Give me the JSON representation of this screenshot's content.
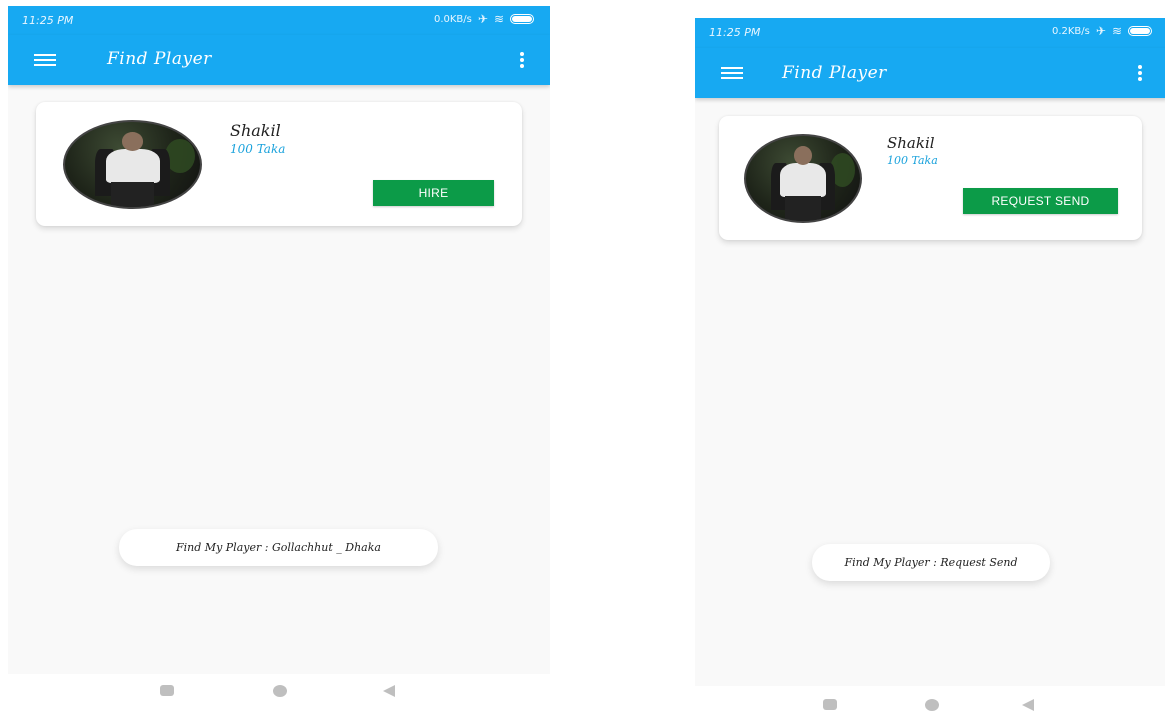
{
  "screens": [
    {
      "status_bar": {
        "time": "11:25 PM",
        "net_speed": "0.0KB/s"
      },
      "app_bar": {
        "title": "Find Player"
      },
      "player": {
        "name": "Shakil",
        "price": "100 Taka",
        "button_label": "HIRE"
      },
      "toast": {
        "text": "Find My Player : Gollachhut _ Dhaka"
      }
    },
    {
      "status_bar": {
        "time": "11:25 PM",
        "net_speed": "0.2KB/s"
      },
      "app_bar": {
        "title": "Find Player"
      },
      "player": {
        "name": "Shakil",
        "price": "100 Taka",
        "button_label": "REQUEST SEND"
      },
      "toast": {
        "text": "Find My Player : Request Send"
      }
    }
  ],
  "icons": {
    "menu": "hamburger-menu-icon",
    "overflow": "three-dot-overflow-icon",
    "airplane": "airplane-mode-icon",
    "wifi": "wifi-icon",
    "battery": "battery-icon",
    "nav_recent": "square-recents-icon",
    "nav_home": "circle-home-icon",
    "nav_back": "triangle-back-icon"
  },
  "colors": {
    "app_bar": "#17a9f2",
    "button": "#0c9b48",
    "price_text": "#1aa2dc",
    "background": "#f9f9f9"
  }
}
